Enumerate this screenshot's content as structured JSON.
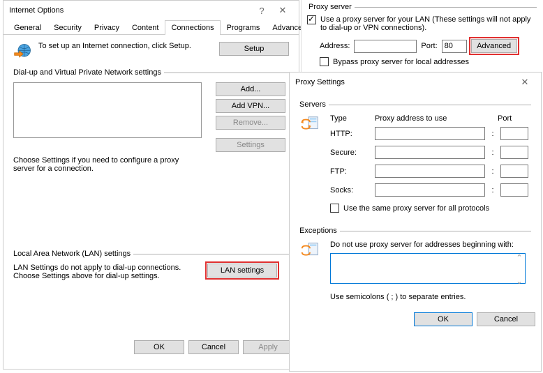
{
  "internetOptions": {
    "title": "Internet Options",
    "help": "?",
    "close": "✕",
    "tabs": {
      "general": "General",
      "security": "Security",
      "privacy": "Privacy",
      "content": "Content",
      "connections": "Connections",
      "programs": "Programs",
      "advanced": "Advanced"
    },
    "activeTab": "connections",
    "setup": {
      "text": "To set up an Internet connection, click Setup.",
      "button": "Setup"
    },
    "dialup": {
      "legend": "Dial-up and Virtual Private Network settings",
      "add": "Add...",
      "addvpn": "Add VPN...",
      "remove": "Remove...",
      "settings": "Settings",
      "note": "Choose Settings if you need to configure a proxy server for a connection."
    },
    "lan": {
      "legend": "Local Area Network (LAN) settings",
      "note": "LAN Settings do not apply to dial-up connections. Choose Settings above for dial-up settings.",
      "button": "LAN settings"
    },
    "footer": {
      "ok": "OK",
      "cancel": "Cancel",
      "apply": "Apply"
    }
  },
  "proxyTop": {
    "legend": "Proxy server",
    "useProxy": "Use a proxy server for your LAN (These settings will not apply to dial-up or VPN connections).",
    "addressLabel": "Address:",
    "addressValue": "",
    "portLabel": "Port:",
    "portValue": "80",
    "advanced": "Advanced",
    "bypass": "Bypass proxy server for local addresses"
  },
  "proxySettings": {
    "title": "Proxy Settings",
    "close": "✕",
    "servers": {
      "legend": "Servers",
      "typeHeader": "Type",
      "addrHeader": "Proxy address to use",
      "portHeader": "Port",
      "rows": {
        "http": {
          "label": "HTTP:",
          "addr": "",
          "port": ""
        },
        "secure": {
          "label": "Secure:",
          "addr": "",
          "port": ""
        },
        "ftp": {
          "label": "FTP:",
          "addr": "",
          "port": ""
        },
        "socks": {
          "label": "Socks:",
          "addr": "",
          "port": ""
        }
      },
      "sameForAll": "Use the same proxy server for all protocols"
    },
    "exceptions": {
      "legend": "Exceptions",
      "note": "Do not use proxy server for addresses beginning with:",
      "value": "",
      "hint": "Use semicolons ( ; ) to separate entries."
    },
    "footer": {
      "ok": "OK",
      "cancel": "Cancel"
    }
  }
}
